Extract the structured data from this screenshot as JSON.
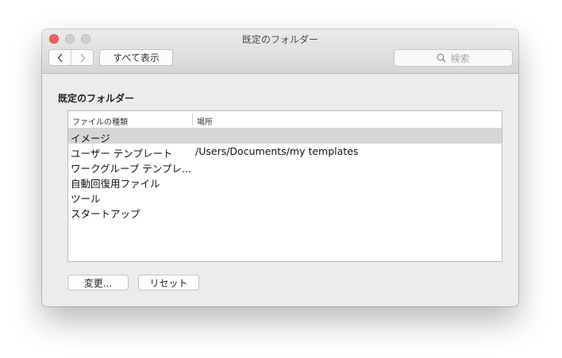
{
  "window": {
    "title": "既定のフォルダー",
    "show_all_label": "すべて表示",
    "search_placeholder": "検索"
  },
  "section": {
    "title": "既定のフォルダー"
  },
  "table": {
    "columns": [
      "ファイルの種類",
      "場所"
    ],
    "selected_index": 0,
    "rows": [
      {
        "type": "イメージ",
        "location": ""
      },
      {
        "type": "ユーザー テンプレート",
        "location": "/Users/Documents/my templates"
      },
      {
        "type": "ワークグループ テンプレ…",
        "location": ""
      },
      {
        "type": "自動回復用ファイル",
        "location": ""
      },
      {
        "type": "ツール",
        "location": ""
      },
      {
        "type": "スタートアップ",
        "location": ""
      }
    ]
  },
  "buttons": {
    "change": "変更...",
    "reset": "リセット"
  },
  "icons": {
    "back": "chevron-left-icon",
    "forward": "chevron-right-icon",
    "search": "search-icon"
  },
  "colors": {
    "close": "#fc5f57",
    "selection": "#d6d6d6"
  }
}
